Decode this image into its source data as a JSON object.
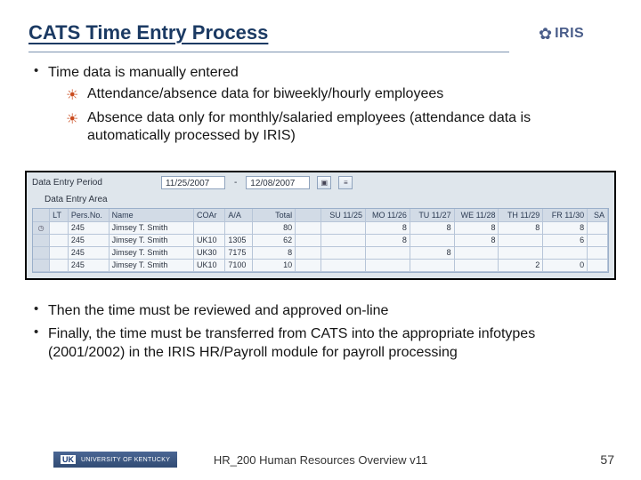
{
  "title": "CATS Time Entry Process",
  "logo": {
    "text": "IRIS"
  },
  "bullets_top": {
    "b1": "Time data is manually entered",
    "s1": "Attendance/absence data for biweekly/hourly employees",
    "s2": "Absence data only for monthly/salaried employees (attendance data is automatically processed by IRIS)"
  },
  "sap": {
    "period_label": "Data Entry Period",
    "period_from": "11/25/2007",
    "period_to": "12/08/2007",
    "area_label": "Data Entry Area",
    "headers": {
      "lt": "LT",
      "pers": "Pers.No.",
      "name": "Name",
      "coar": "COAr",
      "aa": "A/A",
      "total": "Total",
      "su": "SU 11/25",
      "mo": "MO 11/26",
      "tu": "TU 11/27",
      "we": "WE 11/28",
      "th": "TH 11/29",
      "fr": "FR 11/30",
      "sa": "SA"
    },
    "rows": [
      {
        "pers": "245",
        "name": "Jimsey T. Smith",
        "coar": "",
        "aa": "",
        "total": "80",
        "su": "",
        "mo": "8",
        "tu": "8",
        "we": "8",
        "th": "8",
        "fr": "8",
        "sa": ""
      },
      {
        "pers": "245",
        "name": "Jimsey T. Smith",
        "coar": "UK10",
        "aa": "1305",
        "total": "62",
        "su": "",
        "mo": "8",
        "tu": "",
        "we": "8",
        "th": "",
        "fr": "6",
        "sa": ""
      },
      {
        "pers": "245",
        "name": "Jimsey T. Smith",
        "coar": "UK30",
        "aa": "7175",
        "total": "8",
        "su": "",
        "mo": "",
        "tu": "8",
        "we": "",
        "th": "",
        "fr": "",
        "sa": ""
      },
      {
        "pers": "245",
        "name": "Jimsey T. Smith",
        "coar": "UK10",
        "aa": "7100",
        "total": "10",
        "su": "",
        "mo": "",
        "tu": "",
        "we": "",
        "th": "2",
        "fr": "0",
        "sa": ""
      }
    ]
  },
  "bullets_bottom": {
    "b2": "Then the time must be reviewed and approved on-line",
    "b3": "Finally, the time must be transferred from CATS into the appropriate infotypes (2001/2002) in the IRIS HR/Payroll module for payroll processing"
  },
  "footer": {
    "org": "UNIVERSITY OF KENTUCKY",
    "uk": "UK",
    "center": "HR_200 Human Resources Overview v11",
    "page": "57"
  }
}
